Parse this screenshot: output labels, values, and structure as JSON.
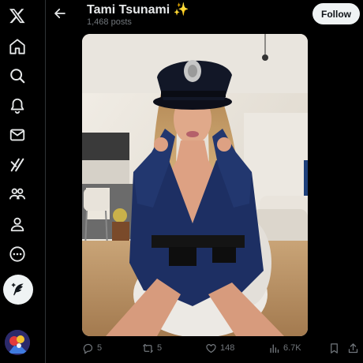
{
  "profile": {
    "name": "Tami Tsunami ✨",
    "posts_count": "1,468 posts"
  },
  "header": {
    "follow_label": "Follow"
  },
  "nav": {
    "items": [
      "x-logo-icon",
      "home-icon",
      "explore-icon",
      "notifications-icon",
      "messages-icon",
      "grok-icon",
      "communities-icon",
      "profile-icon",
      "more-icon"
    ],
    "compose_icon": "compose-feather-icon"
  },
  "media": {
    "alt": "Woman in a navy police-style costume and hat sitting on a chair in a modern living room"
  },
  "actions": {
    "replies": "5",
    "reposts": "5",
    "likes": "148",
    "views": "6.7K"
  },
  "colors": {
    "background": "#000000",
    "text": "#e7e9ea",
    "muted": "#71767b",
    "divider": "#2f3336",
    "button_bg": "#eff3f4"
  }
}
